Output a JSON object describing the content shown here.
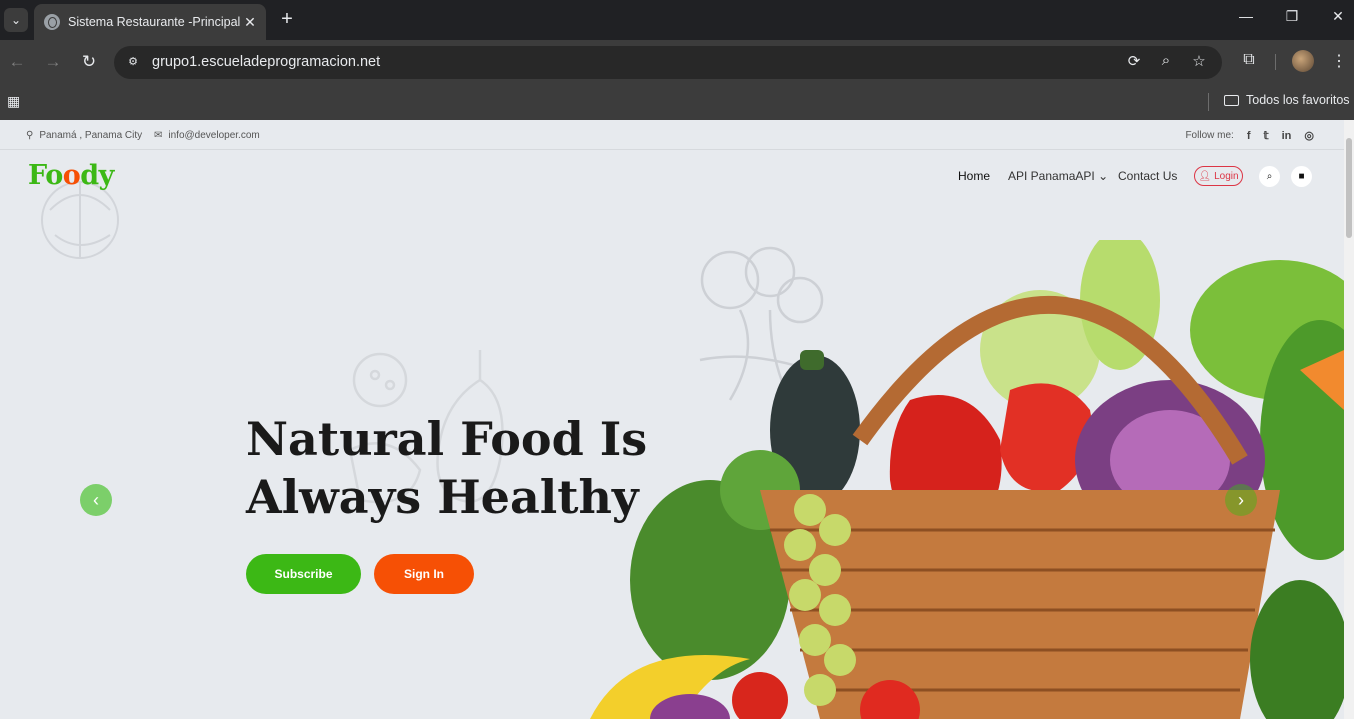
{
  "browser": {
    "tab_title": "Sistema Restaurante -Principal",
    "url": "grupo1.escueladeprogramacion.net",
    "bookmarks_label": "Todos los favoritos"
  },
  "topbar": {
    "location": "Panamá , Panama City",
    "email": "info@developer.com",
    "follow_label": "Follow me:"
  },
  "site": {
    "logo_first": "F",
    "logo_o": "o",
    "logo_o2": "o",
    "logo_rest": "dy"
  },
  "nav": {
    "home": "Home",
    "api": "API PanamaAPI",
    "contact": "Contact Us",
    "login": "Login"
  },
  "hero": {
    "headline_line1": "Natural Food Is",
    "headline_line2": "Always Healthy",
    "subscribe": "Subscribe",
    "signin": "Sign In"
  },
  "colors": {
    "primary": "#3cb815",
    "secondary": "#f65005",
    "login": "#dc3545"
  }
}
